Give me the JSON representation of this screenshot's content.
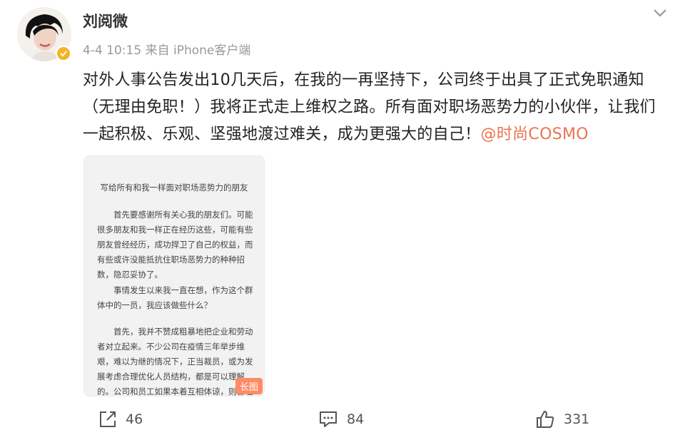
{
  "post": {
    "author": "刘阅微",
    "date": "4-4 10:15",
    "source": "来自 iPhone客户端",
    "text": "对外人事公告发出10几天后，在我的一再坚持下，公司终于出具了正式免职通知（无理由免职！）我将正式走上维权之路。所有面对职场恶势力的小伙伴，让我们一起积极、乐观、坚强地渡过难关，成为更强大的自己！",
    "mention": "@时尚COSMO"
  },
  "long_image": {
    "title": "写给所有和我一样面对职场恶势力的朋友",
    "paragraphs": [
      "首先要感谢所有关心我的朋友们。可能很多朋友和我一样正在经历这些，可能有些朋友曾经经历，成功捍卫了自己的权益，而有些或许没能抵抗住职场恶势力的种种招数，隐忍妥协了。",
      "事情发生以来我一直在想，作为这个群体中的一员，我应该做些什么？",
      "首先，我并不赞成粗暴地把企业和劳动者对立起来。不少公司在疫情三年举步维艰，难以为继的情况下，正当裁员，或为发展考虑合理优化人员结构，都是可以理解的。公司和员工如果本着互相体谅，则合理合法协商解决，各自上路，"
    ],
    "badge": "长图"
  },
  "actions": {
    "repost_count": "46",
    "comment_count": "84",
    "like_count": "331"
  },
  "icons": {
    "repost": "share-icon",
    "comment": "comment-icon",
    "like": "thumbs-up-icon",
    "menu": "chevron-down-icon",
    "verified": "verified-badge-icon"
  },
  "colors": {
    "mention": "#eb7350",
    "badge": "#ff8a65",
    "verified": "#f5b325"
  }
}
